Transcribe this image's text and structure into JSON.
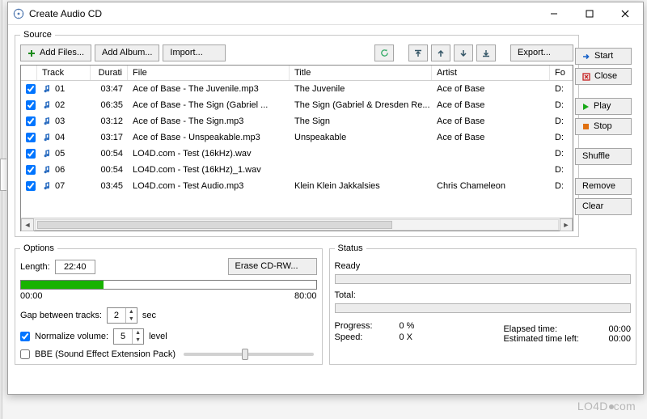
{
  "window": {
    "title": "Create Audio CD"
  },
  "source": {
    "legend": "Source",
    "toolbar": {
      "add_files": "Add Files...",
      "add_album": "Add Album...",
      "import": "Import...",
      "export": "Export..."
    },
    "columns": {
      "track": "Track",
      "duration": "Durati",
      "file": "File",
      "title": "Title",
      "artist": "Artist",
      "fo": "Fo"
    },
    "rows": [
      {
        "chk": true,
        "track": "01",
        "duration": "03:47",
        "file": "Ace of Base - The Juvenile.mp3",
        "title": "The Juvenile",
        "artist": "Ace of Base",
        "fo": "D:"
      },
      {
        "chk": true,
        "track": "02",
        "duration": "06:35",
        "file": "Ace of Base - The Sign (Gabriel ...",
        "title": "The Sign (Gabriel & Dresden Re...",
        "artist": "Ace of Base",
        "fo": "D:"
      },
      {
        "chk": true,
        "track": "03",
        "duration": "03:12",
        "file": "Ace of Base - The Sign.mp3",
        "title": "The Sign",
        "artist": "Ace of Base",
        "fo": "D:"
      },
      {
        "chk": true,
        "track": "04",
        "duration": "03:17",
        "file": "Ace of Base - Unspeakable.mp3",
        "title": "Unspeakable",
        "artist": "Ace of Base",
        "fo": "D:"
      },
      {
        "chk": true,
        "track": "05",
        "duration": "00:54",
        "file": "LO4D.com - Test (16kHz).wav",
        "title": "",
        "artist": "",
        "fo": "D:"
      },
      {
        "chk": true,
        "track": "06",
        "duration": "00:54",
        "file": "LO4D.com - Test (16kHz)_1.wav",
        "title": "",
        "artist": "",
        "fo": "D:"
      },
      {
        "chk": true,
        "track": "07",
        "duration": "03:45",
        "file": "LO4D.com - Test Audio.mp3",
        "title": "Klein Klein Jakkalsies",
        "artist": "Chris Chameleon",
        "fo": "D:"
      }
    ]
  },
  "sidebar": {
    "start": "Start",
    "close": "Close",
    "play": "Play",
    "stop": "Stop",
    "shuffle": "Shuffle",
    "remove": "Remove",
    "clear": "Clear"
  },
  "options": {
    "legend": "Options",
    "length_label": "Length:",
    "length_value": "22:40",
    "scale_min": "00:00",
    "scale_max": "80:00",
    "progress_pct": 28,
    "erase": "Erase CD-RW...",
    "gap_label": "Gap between tracks:",
    "gap_value": "2",
    "gap_unit": "sec",
    "normalize_label": "Normalize volume:",
    "normalize_value": "5",
    "normalize_unit": "level",
    "normalize_checked": true,
    "bbe_label": "BBE (Sound Effect Extension Pack)",
    "bbe_checked": false
  },
  "status": {
    "legend": "Status",
    "ready": "Ready",
    "total_label": "Total:",
    "progress_label": "Progress:",
    "progress_value": "0 %",
    "speed_label": "Speed:",
    "speed_value": "0 X",
    "elapsed_label": "Elapsed time:",
    "elapsed_value": "00:00",
    "eta_label": "Estimated time left:",
    "eta_value": "00:00"
  },
  "watermark": "LO4D",
  "watermark_suffix": "com"
}
